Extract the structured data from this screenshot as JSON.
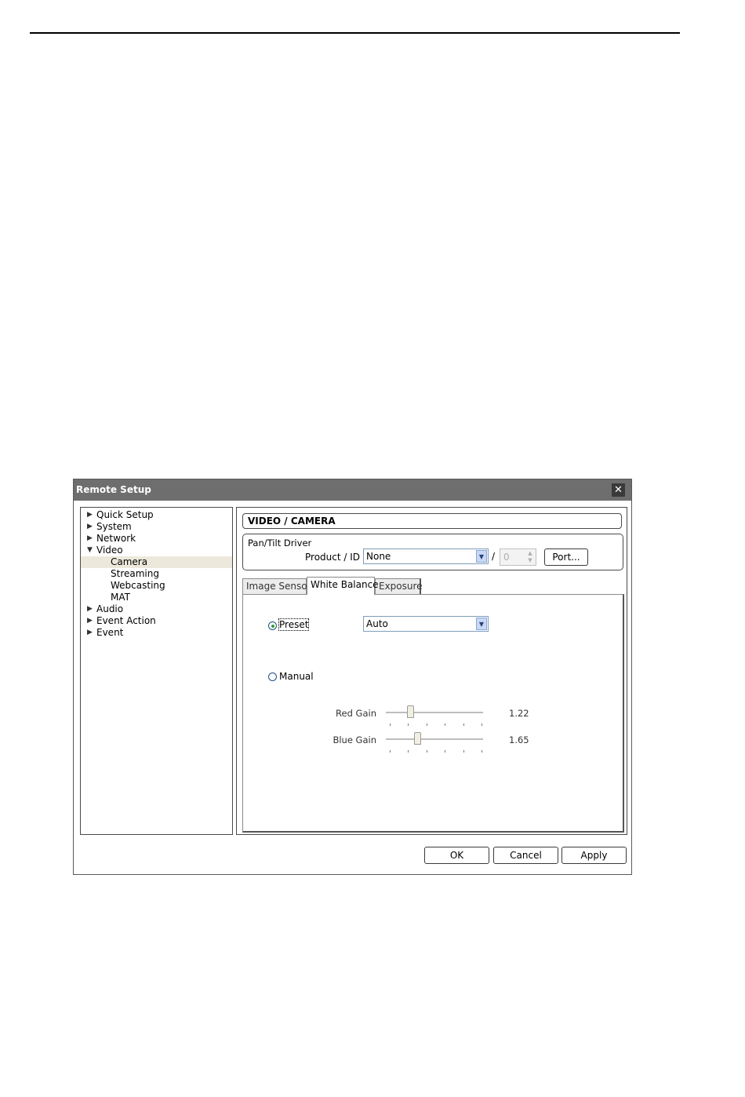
{
  "window": {
    "title": "Remote Setup",
    "close_symbol": "✕"
  },
  "tree": {
    "items": [
      {
        "label": "Quick Setup",
        "level": 0,
        "arrow": "▶"
      },
      {
        "label": "System",
        "level": 0,
        "arrow": "▶"
      },
      {
        "label": "Network",
        "level": 0,
        "arrow": "▶"
      },
      {
        "label": "Video",
        "level": 0,
        "arrow": "▼"
      },
      {
        "label": "Camera",
        "level": 1,
        "arrow": ""
      },
      {
        "label": "Streaming",
        "level": 1,
        "arrow": ""
      },
      {
        "label": "Webcasting",
        "level": 1,
        "arrow": ""
      },
      {
        "label": "MAT",
        "level": 1,
        "arrow": ""
      },
      {
        "label": "Audio",
        "level": 0,
        "arrow": "▶"
      },
      {
        "label": "Event Action",
        "level": 0,
        "arrow": "▶"
      },
      {
        "label": "Event",
        "level": 0,
        "arrow": "▶"
      }
    ],
    "selected": "Camera"
  },
  "content": {
    "section_title": "VIDEO / CAMERA",
    "pan_tilt": {
      "group_label": "Pan/Tilt Driver",
      "product_label": "Product / ID",
      "product_value": "None",
      "separator": "/",
      "id_value": "0",
      "port_button": "Port..."
    },
    "tabs": [
      {
        "label": "Image Sensor",
        "active": false
      },
      {
        "label": "White Balance",
        "active": true
      },
      {
        "label": "Exposure",
        "active": false
      }
    ],
    "white_balance": {
      "preset_label": "Preset",
      "preset_selected": true,
      "preset_value": "Auto",
      "manual_label": "Manual",
      "manual_selected": false,
      "red_gain": {
        "label": "Red Gain",
        "value": "1.22",
        "level": 0.25
      },
      "blue_gain": {
        "label": "Blue Gain",
        "value": "1.65",
        "level": 0.33
      }
    }
  },
  "footer": {
    "ok": "OK",
    "cancel": "Cancel",
    "apply": "Apply"
  },
  "icons": {
    "dropdown": "▼",
    "spin_up": "▲",
    "spin_down": "▼"
  }
}
